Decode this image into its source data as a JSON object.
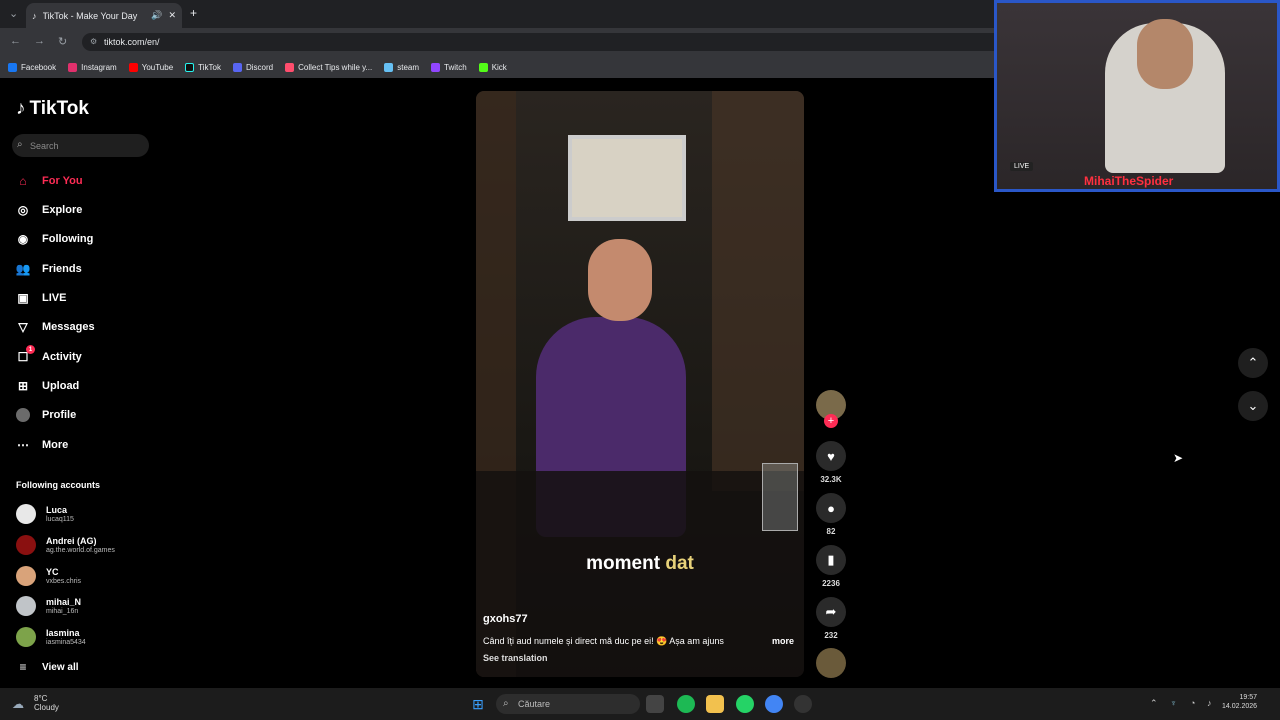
{
  "browser": {
    "tab_title": "TikTok - Make Your Day",
    "url": "tiktok.com/en/",
    "bookmarks": [
      {
        "label": "Facebook",
        "color": "#1877f2"
      },
      {
        "label": "Instagram",
        "color": "#e1306c"
      },
      {
        "label": "YouTube",
        "color": "#ff0000"
      },
      {
        "label": "TikTok",
        "color": "#000000"
      },
      {
        "label": "Discord",
        "color": "#5865f2"
      },
      {
        "label": "Collect Tips while y...",
        "color": "#ff4d6d"
      },
      {
        "label": "steam",
        "color": "#66c0f4"
      },
      {
        "label": "Twitch",
        "color": "#9146ff"
      },
      {
        "label": "Kick",
        "color": "#53fc18"
      }
    ]
  },
  "sidebar": {
    "logo": "TikTok",
    "search_placeholder": "Search",
    "nav": [
      {
        "label": "For You",
        "icon": "home-icon"
      },
      {
        "label": "Explore",
        "icon": "compass-icon"
      },
      {
        "label": "Following",
        "icon": "following-icon"
      },
      {
        "label": "Friends",
        "icon": "friends-icon"
      },
      {
        "label": "LIVE",
        "icon": "live-icon"
      },
      {
        "label": "Messages",
        "icon": "messages-icon"
      },
      {
        "label": "Activity",
        "icon": "activity-icon",
        "badge": "1"
      },
      {
        "label": "Upload",
        "icon": "upload-icon"
      },
      {
        "label": "Profile",
        "icon": "avatar"
      },
      {
        "label": "More",
        "icon": "more-icon"
      }
    ],
    "following_title": "Following accounts",
    "accounts": [
      {
        "name": "Luca",
        "handle": "lucaq115"
      },
      {
        "name": "Andrei (AG)",
        "handle": "ag.the.world.of.games"
      },
      {
        "name": "YC",
        "handle": "vxbes.chris"
      },
      {
        "name": "mihai_N",
        "handle": "mihai_16n"
      },
      {
        "name": "Iasmina",
        "handle": "iasmina5434"
      }
    ],
    "view_all": "View all"
  },
  "video": {
    "caption_white": "moment",
    "caption_yellow": "dat",
    "username": "gxohs77",
    "description": "Când îți aud numele și direct mă duc pe ei! 😍 Așa am ajuns",
    "more": "more",
    "see_translation": "See translation"
  },
  "actions": {
    "likes": "32.3K",
    "comments": "82",
    "saves": "2236",
    "shares": "232"
  },
  "webcam": {
    "name": "MihaiTheSpider",
    "live": "LIVE"
  },
  "taskbar": {
    "weather_temp": "8°C",
    "weather_desc": "Cloudy",
    "search": "Căutare",
    "time": "19:57",
    "date": "14.02.2026"
  }
}
